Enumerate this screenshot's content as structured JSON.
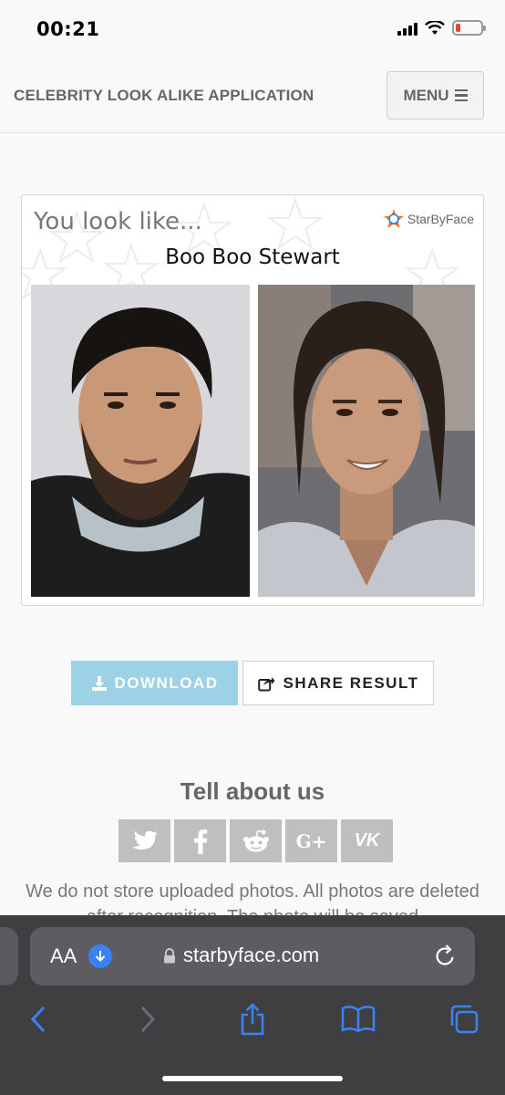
{
  "status_bar": {
    "time": "00:21"
  },
  "header": {
    "title": "CELEBRITY LOOK ALIKE APPLICATION",
    "menu_label": "MENU"
  },
  "result": {
    "heading": "You look like...",
    "celebrity_name": "Boo Boo Stewart",
    "brand": "StarByFace"
  },
  "actions": {
    "download_label": "DOWNLOAD",
    "share_label": "SHARE RESULT"
  },
  "social": {
    "title": "Tell about us",
    "buttons": [
      {
        "icon": "twitter-icon"
      },
      {
        "icon": "facebook-icon"
      },
      {
        "icon": "reddit-icon"
      },
      {
        "icon": "google-plus-icon",
        "label": "G+"
      },
      {
        "icon": "vk-icon",
        "label": "VK"
      }
    ]
  },
  "privacy_text": "We do not store uploaded photos. All photos are deleted after recognition. The photo will be saved",
  "browser": {
    "aa_label": "AA",
    "url": "starbyface.com"
  },
  "colors": {
    "download_bg": "#9dd2e6",
    "safari_bar": "#3f3f42",
    "accent_blue": "#3a82f7",
    "battery_low": "#e5463a"
  }
}
